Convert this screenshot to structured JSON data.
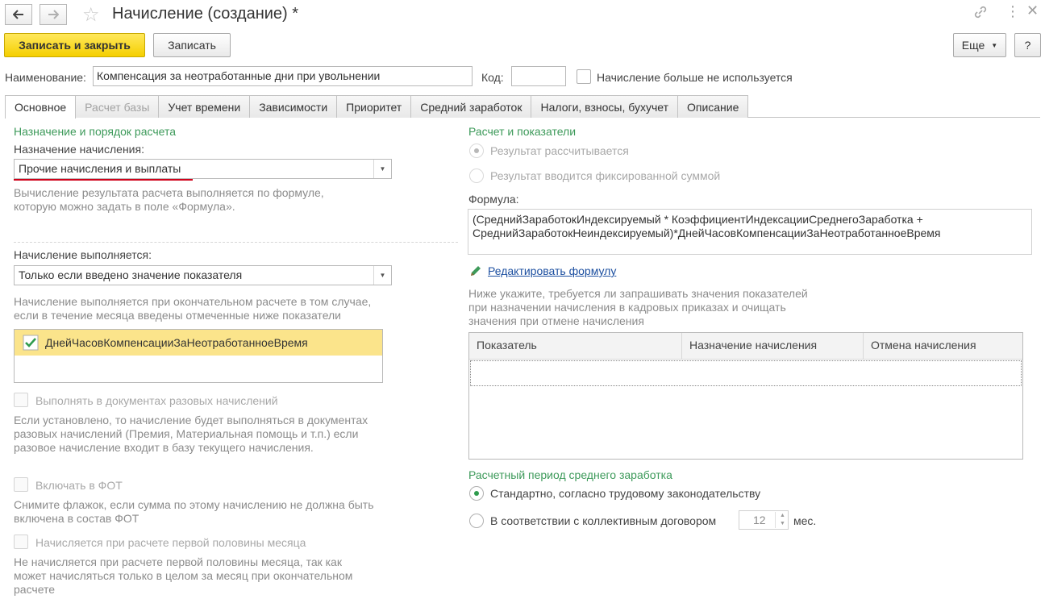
{
  "window": {
    "title": "Начисление (создание) *"
  },
  "toolbar": {
    "save_close_label": "Записать и закрыть",
    "save_label": "Записать",
    "more_label": "Еще",
    "help_label": "?"
  },
  "header": {
    "name_label": "Наименование:",
    "name_value": "Компенсация за неотработанные дни при увольнении",
    "code_label": "Код:",
    "code_value": "",
    "unused_label": "Начисление больше не используется",
    "unused_checked": false
  },
  "tabs": [
    {
      "label": "Основное",
      "active": true,
      "disabled": false
    },
    {
      "label": "Расчет базы",
      "active": false,
      "disabled": true
    },
    {
      "label": "Учет времени",
      "active": false,
      "disabled": false
    },
    {
      "label": "Зависимости",
      "active": false,
      "disabled": false
    },
    {
      "label": "Приоритет",
      "active": false,
      "disabled": false
    },
    {
      "label": "Средний заработок",
      "active": false,
      "disabled": false
    },
    {
      "label": "Налоги, взносы, бухучет",
      "active": false,
      "disabled": false
    },
    {
      "label": "Описание",
      "active": false,
      "disabled": false
    }
  ],
  "left": {
    "group_title": "Назначение и порядок расчета",
    "purpose_label": "Назначение начисления:",
    "purpose_value": "Прочие начисления и выплаты",
    "purpose_hint": "Вычисление результата расчета выполняется по формуле, которую можно задать в поле «Формула».",
    "performed_label": "Начисление выполняется:",
    "performed_value": "Только если введено значение показателя",
    "performed_hint": "Начисление выполняется при окончательном расчете в том случае, если в течение месяца введены отмеченные ниже показатели",
    "indicator_item": "ДнейЧасовКомпенсацииЗаНеотработанноеВремя",
    "one_time_label": "Выполнять в документах разовых начислений",
    "one_time_hint": "Если установлено, то начисление будет выполняться в документах разовых начислений (Премия, Материальная помощь и т.п.) если разовое начисление входит в базу текущего начисления.",
    "fot_label": "Включать в ФОТ",
    "fot_hint": "Снимите флажок, если сумма по этому начислению не должна быть включена в состав ФОТ",
    "first_half_label": "Начисляется при расчете первой половины месяца",
    "first_half_hint": "Не начисляется при расчете первой половины месяца, так как может начисляться только в целом за месяц при окончательном расчете"
  },
  "right": {
    "group_title": "Расчет и показатели",
    "radio_calc_label": "Результат рассчитывается",
    "radio_fixed_label": "Результат вводится фиксированной суммой",
    "formula_label": "Формула:",
    "formula_line1": "(СреднийЗаработокИндексируемый * КоэффициентИндексацииСреднегоЗаработка +",
    "formula_line2": "СреднийЗаработокНеиндексируемый)*ДнейЧасовКомпенсацииЗаНеотработанноеВремя",
    "edit_formula_link": "Редактировать формулу",
    "indicators_hint": "Ниже укажите, требуется ли запрашивать значения показателей при назначении начисления в кадровых приказах и очищать значения при отмене начисления",
    "table_headers": [
      "Показатель",
      "Назначение начисления",
      "Отмена начисления"
    ],
    "avg_period_title": "Расчетный период среднего заработка",
    "avg_standard_label": "Стандартно, согласно трудовому законодательству",
    "avg_collective_label": "В соответствии с коллективным договором",
    "months_value": "12",
    "months_unit": "мес."
  },
  "colors": {
    "accent_green": "#3d9a5a",
    "primary_yellow": "#f5cf00",
    "link_blue": "#1c4fa0",
    "underline_red": "#d0021b",
    "selected_row": "#fbe48b"
  }
}
